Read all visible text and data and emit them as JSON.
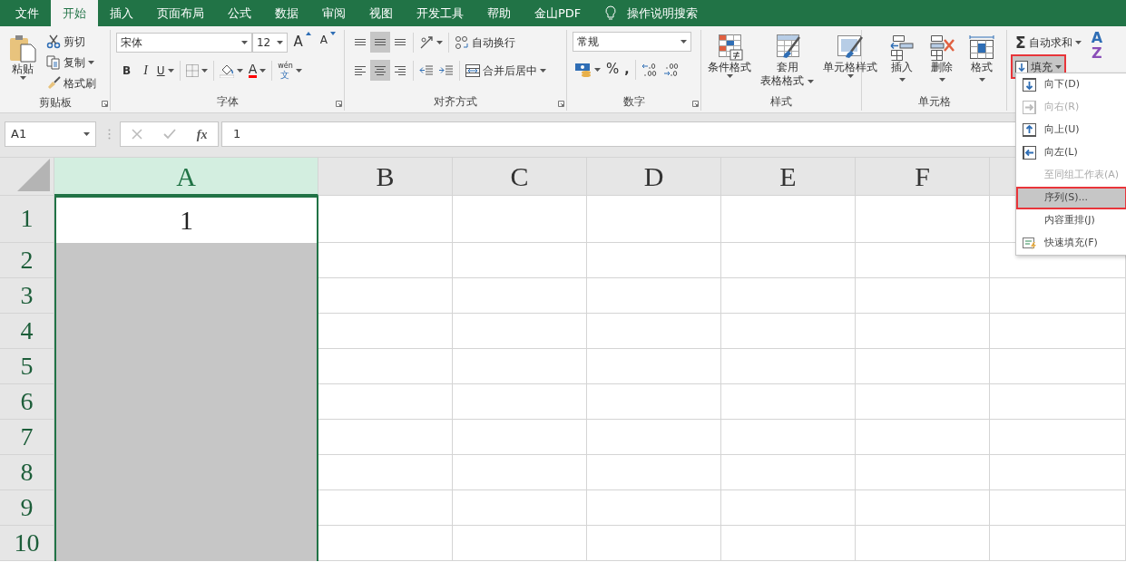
{
  "tabs": [
    {
      "label": "文件",
      "selected": false
    },
    {
      "label": "开始",
      "selected": true
    },
    {
      "label": "插入",
      "selected": false
    },
    {
      "label": "页面布局",
      "selected": false
    },
    {
      "label": "公式",
      "selected": false
    },
    {
      "label": "数据",
      "selected": false
    },
    {
      "label": "审阅",
      "selected": false
    },
    {
      "label": "视图",
      "selected": false
    },
    {
      "label": "开发工具",
      "selected": false
    },
    {
      "label": "帮助",
      "selected": false
    },
    {
      "label": "金山PDF",
      "selected": false
    }
  ],
  "tell_me": {
    "label": "操作说明搜索"
  },
  "clipboard": {
    "paste": "粘贴",
    "cut": "剪切",
    "copy": "复制",
    "format_painter": "格式刷",
    "label": "剪贴板"
  },
  "font": {
    "name": "宋体",
    "size": "12",
    "grow": "A",
    "shrink": "A",
    "bold": "B",
    "italic": "I",
    "underline": "U",
    "font_color": "A",
    "phonetic": [
      "wén",
      "文"
    ],
    "label": "字体"
  },
  "alignment": {
    "vertical": [
      {
        "selected": false
      },
      {
        "selected": true
      },
      {
        "selected": false
      }
    ],
    "horizontal": [
      {
        "selected": false
      },
      {
        "selected": true
      },
      {
        "selected": false
      }
    ],
    "wrap": "自动换行",
    "merge": "合并后居中",
    "label": "对齐方式"
  },
  "number": {
    "format": "常规",
    "percent": "%",
    "comma": ",",
    "label": "数字"
  },
  "styles": {
    "conditional": "条件格式",
    "table": [
      "套用",
      "表格格式"
    ],
    "cell_styles": "单元格样式",
    "label": "样式"
  },
  "cells": {
    "insert": "插入",
    "delete": "删除",
    "format": "格式",
    "label": "单元格"
  },
  "editing": {
    "sigma": "Σ",
    "autosum": "自动求和",
    "fill": "填充",
    "fill_open": true,
    "sort_letters": [
      "A",
      "Z"
    ]
  },
  "formula_bar": {
    "name_box": "A1",
    "fx": "fx",
    "value": "1"
  },
  "sheet": {
    "columns": [
      {
        "label": "A",
        "selected": true
      },
      {
        "label": "B",
        "selected": false
      },
      {
        "label": "C",
        "selected": false
      },
      {
        "label": "D",
        "selected": false
      },
      {
        "label": "E",
        "selected": false
      },
      {
        "label": "F",
        "selected": false
      }
    ],
    "rows": [
      {
        "label": "1",
        "value": "1",
        "active": true,
        "selected": true
      },
      {
        "label": "2",
        "active": false,
        "selected": true
      },
      {
        "label": "3",
        "active": false,
        "selected": true
      },
      {
        "label": "4",
        "active": false,
        "selected": true
      },
      {
        "label": "5",
        "active": false,
        "selected": true
      },
      {
        "label": "6",
        "active": false,
        "selected": true
      },
      {
        "label": "7",
        "active": false,
        "selected": true
      },
      {
        "label": "8",
        "active": false,
        "selected": true
      },
      {
        "label": "9",
        "active": false,
        "selected": true
      },
      {
        "label": "10",
        "active": false,
        "selected": true
      }
    ]
  },
  "fill_menu": {
    "items": [
      {
        "label": "向下(D)",
        "kind": "down",
        "disabled": false,
        "selected": false
      },
      {
        "label": "向右(R)",
        "kind": "right",
        "disabled": true,
        "selected": false
      },
      {
        "label": "向上(U)",
        "kind": "up",
        "disabled": false,
        "selected": false
      },
      {
        "label": "向左(L)",
        "kind": "left",
        "disabled": false,
        "selected": false
      },
      {
        "label": "至同组工作表(A)",
        "kind": "none",
        "disabled": true,
        "selected": false
      },
      {
        "label": "序列(S)...",
        "kind": "none",
        "disabled": false,
        "selected": true
      },
      {
        "label": "内容重排(J)",
        "kind": "none",
        "disabled": false,
        "selected": false
      },
      {
        "label": "快速填充(F)",
        "kind": "flash",
        "disabled": false,
        "selected": false
      }
    ]
  }
}
